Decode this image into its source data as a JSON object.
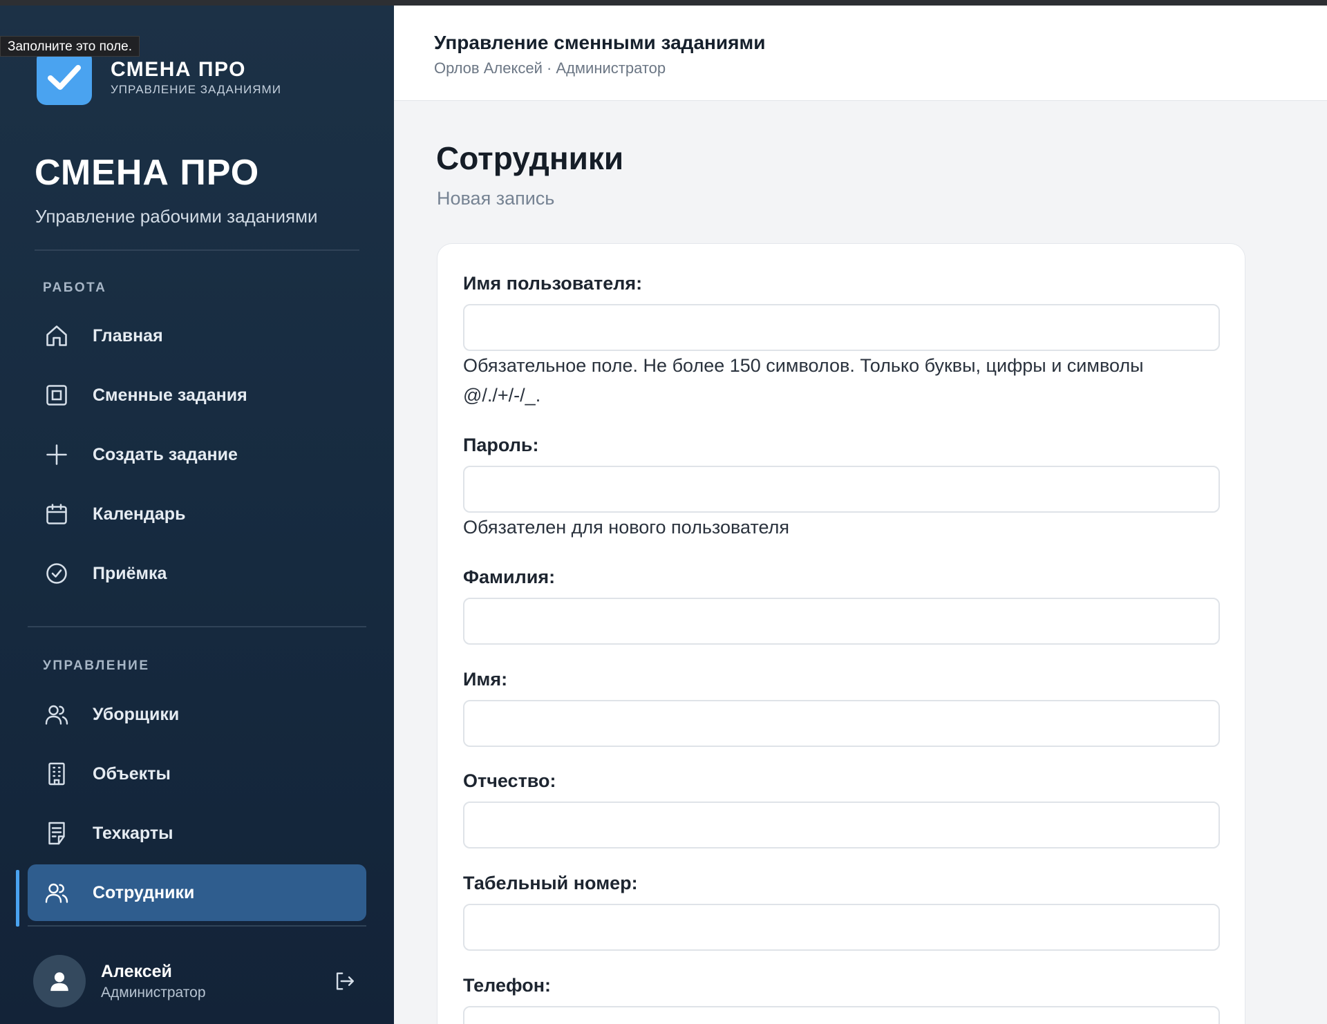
{
  "tooltip": "Заполните это поле.",
  "brand": {
    "title": "СМЕНА ПРО",
    "subtitle": "УПРАВЛЕНИЕ ЗАДАНИЯМИ"
  },
  "hero": {
    "title": "СМЕНА ПРО",
    "subtitle": "Управление рабочими заданиями"
  },
  "sidebar": {
    "sections": [
      {
        "label": "РАБОТА",
        "items": [
          {
            "label": "Главная",
            "icon": "home-icon"
          },
          {
            "label": "Сменные задания",
            "icon": "square-icon"
          },
          {
            "label": "Создать задание",
            "icon": "plus-icon"
          },
          {
            "label": "Календарь",
            "icon": "calendar-icon"
          },
          {
            "label": "Приёмка",
            "icon": "check-circle-icon"
          }
        ]
      },
      {
        "label": "УПРАВЛЕНИЕ",
        "items": [
          {
            "label": "Уборщики",
            "icon": "users-icon"
          },
          {
            "label": "Объекты",
            "icon": "building-icon"
          },
          {
            "label": "Техкарты",
            "icon": "document-icon"
          },
          {
            "label": "Сотрудники",
            "icon": "users-icon",
            "active": true
          }
        ]
      }
    ]
  },
  "user": {
    "name": "Алексей",
    "role": "Администратор"
  },
  "header": {
    "title": "Управление сменными заданиями",
    "subtitle": "Орлов Алексей · Администратор"
  },
  "page": {
    "title": "Сотрудники",
    "subtitle": "Новая запись"
  },
  "form": {
    "username": {
      "label": "Имя пользователя:",
      "value": "",
      "help": "Обязательное поле. Не более 150 символов. Только буквы, цифры и символы @/./+/-/_."
    },
    "password": {
      "label": "Пароль:",
      "value": "",
      "help": "Обязателен для нового пользователя"
    },
    "last_name": {
      "label": "Фамилия:",
      "value": ""
    },
    "first_name": {
      "label": "Имя:",
      "value": ""
    },
    "middle_name": {
      "label": "Отчество:",
      "value": ""
    },
    "employee_number": {
      "label": "Табельный номер:",
      "value": ""
    },
    "phone": {
      "label": "Телефон:",
      "value": ""
    }
  },
  "colors": {
    "sidebar": "#1c3146",
    "accent": "#4aa3f0",
    "active": "#2f5d8e"
  }
}
